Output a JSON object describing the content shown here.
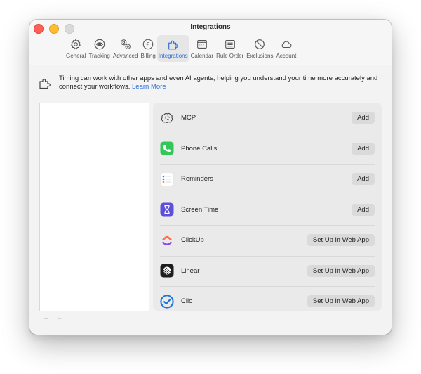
{
  "window": {
    "title": "Integrations"
  },
  "toolbar": {
    "items": [
      {
        "label": "General",
        "icon": "gear-icon"
      },
      {
        "label": "Tracking",
        "icon": "eye-icon"
      },
      {
        "label": "Advanced",
        "icon": "gears-icon"
      },
      {
        "label": "Billing",
        "icon": "euro-icon"
      },
      {
        "label": "Integrations",
        "icon": "puzzle-icon",
        "active": true
      },
      {
        "label": "Calendar",
        "icon": "calendar-icon"
      },
      {
        "label": "Rule Order",
        "icon": "list-icon"
      },
      {
        "label": "Exclusions",
        "icon": "prohibited-icon"
      },
      {
        "label": "Account",
        "icon": "cloud-icon"
      }
    ],
    "accent_color": "#2f6fd6"
  },
  "intro": {
    "text": "Timing can work with other apps and even AI agents, helping you understand your time more accurately and connect your workflows.",
    "link": "Learn More"
  },
  "list_buttons": {
    "add": "+",
    "remove": "−"
  },
  "integrations": [
    {
      "name": "MCP",
      "action": "Add",
      "icon": "brain-icon"
    },
    {
      "name": "Phone Calls",
      "action": "Add",
      "icon": "phone-icon"
    },
    {
      "name": "Reminders",
      "action": "Add",
      "icon": "reminders-icon"
    },
    {
      "name": "Screen Time",
      "action": "Add",
      "icon": "hourglass-icon"
    },
    {
      "name": "ClickUp",
      "action": "Set Up in Web App",
      "icon": "clickup-icon"
    },
    {
      "name": "Linear",
      "action": "Set Up in Web App",
      "icon": "linear-icon"
    },
    {
      "name": "Clio",
      "action": "Set Up in Web App",
      "icon": "clio-icon"
    }
  ]
}
